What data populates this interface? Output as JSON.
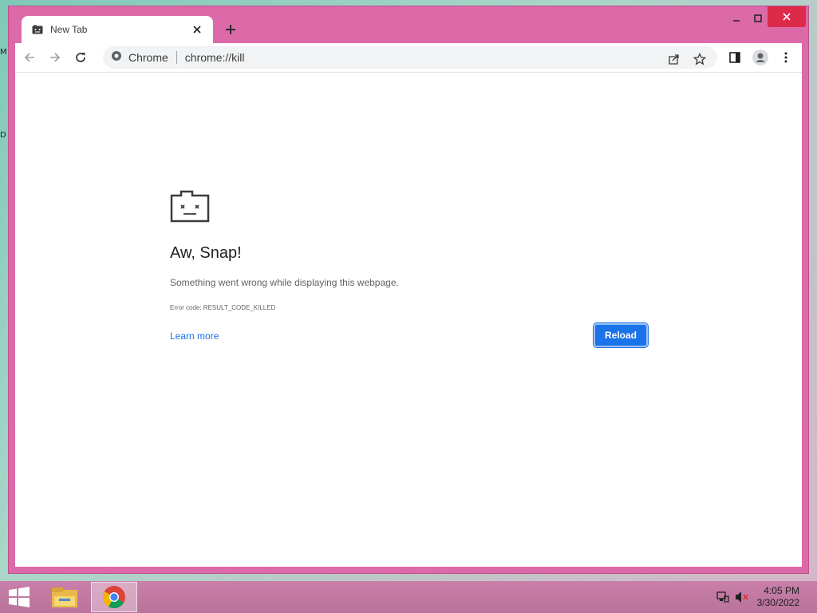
{
  "browser": {
    "tab_title": "New Tab",
    "omnibox_site": "Chrome",
    "omnibox_url": "chrome://kill"
  },
  "error_page": {
    "title": "Aw, Snap!",
    "message": "Something went wrong while displaying this webpage.",
    "error_code": "Error code: RESULT_CODE_KILLED",
    "learn_more": "Learn more",
    "reload_label": "Reload"
  },
  "taskbar": {
    "time": "4:05 PM",
    "date": "3/30/2022"
  },
  "desktop": {
    "fragment_1": "M",
    "fragment_2": "D"
  },
  "colors": {
    "window_frame": "#dc6aa8",
    "accent": "#1a73e8",
    "close_button": "#dc2a4a"
  },
  "icons": [
    "sad-tab-icon",
    "close-icon",
    "plus-icon",
    "back-icon",
    "forward-icon",
    "reload-icon",
    "chrome-icon",
    "share-icon",
    "star-icon",
    "side-panel-icon",
    "profile-icon",
    "menu-icon",
    "windows-start-icon",
    "file-explorer-icon",
    "chrome-app-icon",
    "network-icon",
    "volume-muted-icon"
  ]
}
